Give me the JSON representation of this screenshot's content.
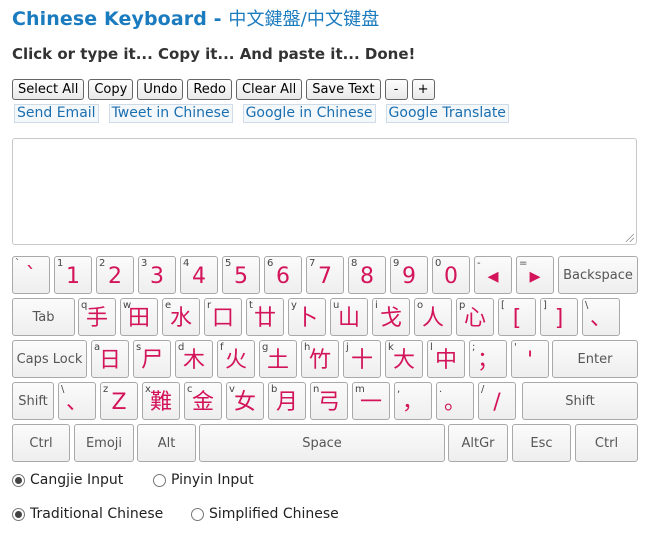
{
  "header": {
    "title": "Chinese Keyboard",
    "dash": " - ",
    "subtitle": "中文鍵盤/中文键盘",
    "tagline": "Click or type it... Copy it... And paste it... Done!"
  },
  "toolbar": {
    "buttons": [
      "Select All",
      "Copy",
      "Undo",
      "Redo",
      "Clear All",
      "Save Text",
      "-",
      "+"
    ]
  },
  "links": [
    "Send Email",
    "Tweet in Chinese",
    "Google in Chinese",
    "Google Translate"
  ],
  "editor": {
    "value": ""
  },
  "keyboard": {
    "row1": [
      {
        "s": "`",
        "b": "`"
      },
      {
        "s": "1",
        "b": "1"
      },
      {
        "s": "2",
        "b": "2"
      },
      {
        "s": "3",
        "b": "3"
      },
      {
        "s": "4",
        "b": "4"
      },
      {
        "s": "5",
        "b": "5"
      },
      {
        "s": "6",
        "b": "6"
      },
      {
        "s": "7",
        "b": "7"
      },
      {
        "s": "8",
        "b": "8"
      },
      {
        "s": "9",
        "b": "9"
      },
      {
        "s": "0",
        "b": "0"
      },
      {
        "s": "-",
        "b": "◂"
      },
      {
        "s": "=",
        "b": "▸"
      }
    ],
    "row2": [
      {
        "s": "q",
        "b": "手"
      },
      {
        "s": "w",
        "b": "田"
      },
      {
        "s": "e",
        "b": "水"
      },
      {
        "s": "r",
        "b": "口"
      },
      {
        "s": "t",
        "b": "廿"
      },
      {
        "s": "y",
        "b": "卜"
      },
      {
        "s": "u",
        "b": "山"
      },
      {
        "s": "i",
        "b": "戈"
      },
      {
        "s": "o",
        "b": "人"
      },
      {
        "s": "p",
        "b": "心"
      },
      {
        "s": "[",
        "b": "["
      },
      {
        "s": "]",
        "b": "]"
      },
      {
        "s": "\\",
        "b": "、"
      }
    ],
    "row3": [
      {
        "s": "a",
        "b": "日"
      },
      {
        "s": "s",
        "b": "尸"
      },
      {
        "s": "d",
        "b": "木"
      },
      {
        "s": "f",
        "b": "火"
      },
      {
        "s": "g",
        "b": "土"
      },
      {
        "s": "h",
        "b": "竹"
      },
      {
        "s": "j",
        "b": "十"
      },
      {
        "s": "k",
        "b": "大"
      },
      {
        "s": "l",
        "b": "中"
      },
      {
        "s": ";",
        "b": "；"
      },
      {
        "s": "'",
        "b": "'"
      }
    ],
    "row4": [
      {
        "s": "\\",
        "b": "、"
      },
      {
        "s": "z",
        "b": "Z"
      },
      {
        "s": "x",
        "b": "難"
      },
      {
        "s": "c",
        "b": "金"
      },
      {
        "s": "v",
        "b": "女"
      },
      {
        "s": "b",
        "b": "月"
      },
      {
        "s": "n",
        "b": "弓"
      },
      {
        "s": "m",
        "b": "一"
      },
      {
        "s": ",",
        "b": "，"
      },
      {
        "s": ".",
        "b": "。"
      },
      {
        "s": "/",
        "b": "/"
      }
    ],
    "special": {
      "backspace": "Backspace",
      "tab": "Tab",
      "capslock": "Caps Lock",
      "enter": "Enter",
      "shift": "Shift",
      "ctrl": "Ctrl",
      "emoji": "Emoji",
      "alt": "Alt",
      "space": "Space",
      "altgr": "AltGr",
      "esc": "Esc"
    }
  },
  "input_method": {
    "options": [
      {
        "label": "Cangjie Input",
        "selected": true
      },
      {
        "label": "Pinyin Input",
        "selected": false
      }
    ]
  },
  "script_type": {
    "options": [
      {
        "label": "Traditional Chinese",
        "selected": true
      },
      {
        "label": "Simplified Chinese",
        "selected": false
      }
    ]
  },
  "colors": {
    "title": "#1a7bbf",
    "key_char": "#d3145a",
    "link": "#1a6fb0"
  }
}
